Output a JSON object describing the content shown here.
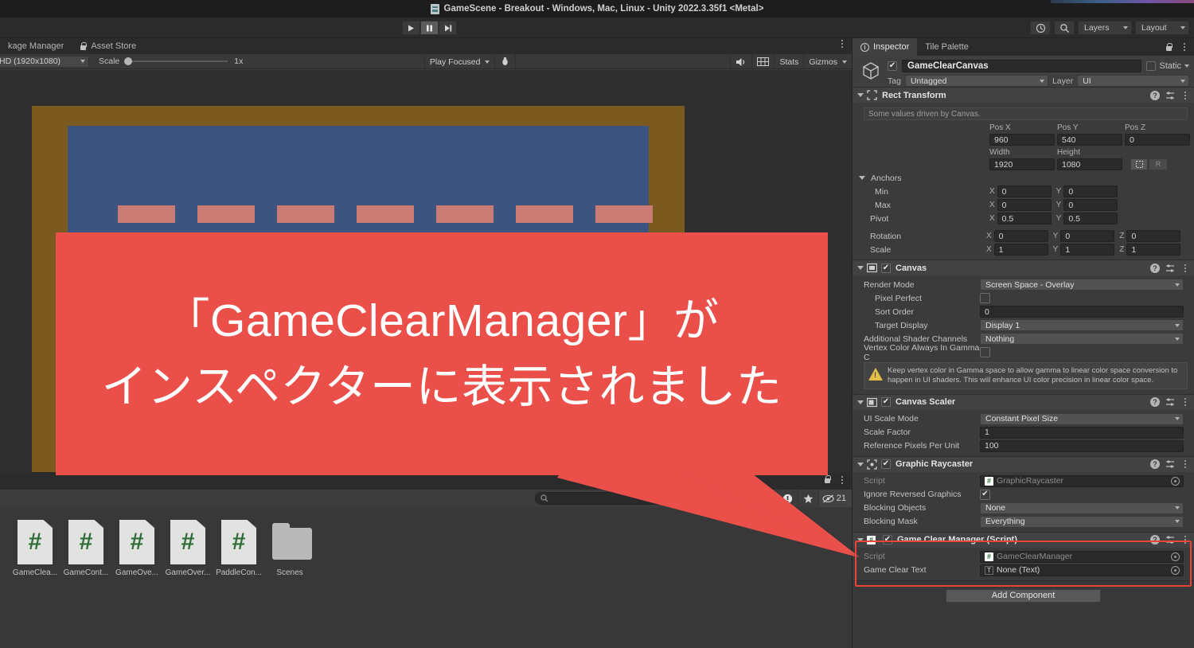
{
  "window": {
    "title": "GameScene - Breakout - Windows, Mac, Linux - Unity 2022.3.35f1 <Metal>"
  },
  "toolbar": {
    "play_label": "play-icon",
    "pause_label": "pause-icon",
    "step_label": "step-icon",
    "history_icon": "history-icon",
    "search_icon": "search-icon",
    "layers_label": "Layers",
    "layout_label": "Layout"
  },
  "game_panel": {
    "tabs": [
      {
        "label": "kage Manager",
        "icon": ""
      },
      {
        "label": "Asset Store",
        "icon": "lock-icon"
      }
    ],
    "aspect": "HD (1920x1080)",
    "scale_label": "Scale",
    "scale_value": "1x",
    "play_mode": "Play Focused",
    "mute_icon": "speaker-icon",
    "frame_icon": "frame-debug-icon",
    "stats_label": "Stats",
    "gizmos_label": "Gizmos"
  },
  "project_panel": {
    "search_placeholder": "",
    "warning_count": "21",
    "assets": [
      {
        "label": "GameClea...",
        "type": "cs"
      },
      {
        "label": "GameCont...",
        "type": "cs"
      },
      {
        "label": "GameOve...",
        "type": "cs"
      },
      {
        "label": "GameOver...",
        "type": "cs"
      },
      {
        "label": "PaddleCon...",
        "type": "cs"
      },
      {
        "label": "Scenes",
        "type": "folder"
      }
    ]
  },
  "inspector": {
    "tabs": [
      {
        "label": "Inspector",
        "selected": true
      },
      {
        "label": "Tile Palette",
        "selected": false
      }
    ],
    "object_name": "GameClearCanvas",
    "static_label": "Static",
    "tag_label": "Tag",
    "tag_value": "Untagged",
    "layer_label": "Layer",
    "layer_value": "UI",
    "components": [
      {
        "title": "Rect Transform",
        "info": "Some values driven by Canvas.",
        "cols": [
          "Pos X",
          "Pos Y",
          "Pos Z"
        ],
        "pos": [
          "960",
          "540",
          "0"
        ],
        "cols2": [
          "Width",
          "Height"
        ],
        "size": [
          "1920",
          "1080"
        ],
        "anchors_label": "Anchors",
        "min_label": "Min",
        "min": [
          "0",
          "0"
        ],
        "max_label": "Max",
        "max": [
          "0",
          "0"
        ],
        "pivot_label": "Pivot",
        "pivot": [
          "0.5",
          "0.5"
        ],
        "rotation_label": "Rotation",
        "rotation": [
          "0",
          "0",
          "0"
        ],
        "scale_label": "Scale",
        "scale": [
          "1",
          "1",
          "1"
        ],
        "blueprint_btn": "R"
      },
      {
        "title": "Canvas",
        "rows": [
          {
            "label": "Render Mode",
            "value": "Screen Space - Overlay",
            "kind": "dropdown"
          },
          {
            "label": "Pixel Perfect",
            "value": "",
            "kind": "checkbox",
            "indent": 1
          },
          {
            "label": "Sort Order",
            "value": "0",
            "kind": "field",
            "indent": 1
          },
          {
            "label": "Target Display",
            "value": "Display 1",
            "kind": "dropdown",
            "indent": 1
          },
          {
            "label": "Additional Shader Channels",
            "value": "Nothing",
            "kind": "dropdown"
          },
          {
            "label": "Vertex Color Always In Gamma C",
            "value": "",
            "kind": "checkbox"
          }
        ],
        "help": "Keep vertex color in Gamma space to allow gamma to linear color space conversion to happen in UI shaders. This will enhance UI color precision in linear color space."
      },
      {
        "title": "Canvas Scaler",
        "rows": [
          {
            "label": "UI Scale Mode",
            "value": "Constant Pixel Size",
            "kind": "dropdown"
          },
          {
            "label": "Scale Factor",
            "value": "1",
            "kind": "field"
          },
          {
            "label": "Reference Pixels Per Unit",
            "value": "100",
            "kind": "field"
          }
        ]
      },
      {
        "title": "Graphic Raycaster",
        "rows": [
          {
            "label": "Script",
            "value": "GraphicRaycaster",
            "kind": "object",
            "disabled": true
          },
          {
            "label": "Ignore Reversed Graphics",
            "value": "",
            "kind": "checkbox-on"
          },
          {
            "label": "Blocking Objects",
            "value": "None",
            "kind": "dropdown"
          },
          {
            "label": "Blocking Mask",
            "value": "Everything",
            "kind": "dropdown"
          }
        ]
      },
      {
        "title": "Game Clear Manager (Script)",
        "highlighted": true,
        "rows": [
          {
            "label": "Script",
            "value": "GameClearManager",
            "kind": "object",
            "disabled": true
          },
          {
            "label": "Game Clear Text",
            "value": "None (Text)",
            "kind": "object"
          }
        ]
      }
    ],
    "add_component_label": "Add Component"
  },
  "callout": {
    "line1": "「GameClearManager」が",
    "line2": "インスペクターに表示されました",
    "color": "#ea4f4a"
  },
  "colors": {
    "accent_red": "#ea4f4a",
    "panel_bg": "#383838",
    "header_bg": "#2b2b2b",
    "game_bg_brown": "#7a5a1e",
    "game_panel_blue": "#3d5480",
    "brick": "#ca7b74"
  }
}
